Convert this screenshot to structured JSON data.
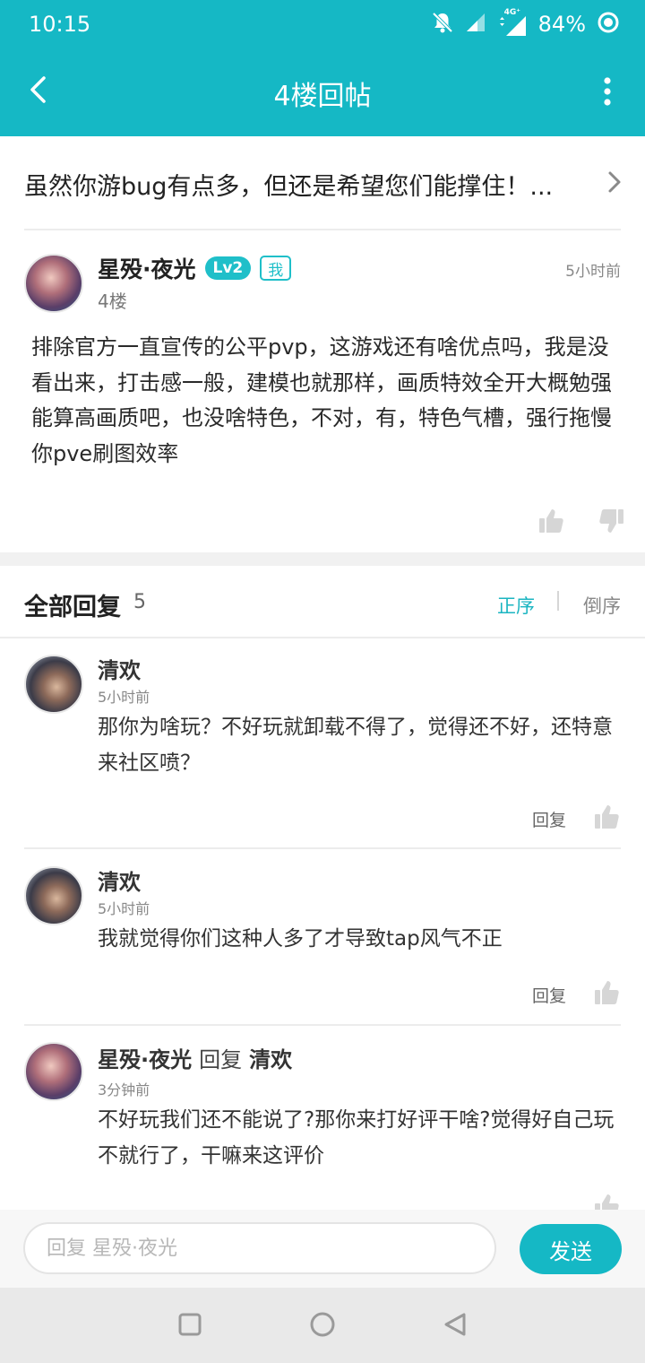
{
  "status_bar": {
    "time": "10:15",
    "battery_percent": "84%",
    "network_label": "4G⁺",
    "icons": [
      "notifications-off-icon",
      "signal-icon",
      "network-4g-icon",
      "battery-ring-icon"
    ]
  },
  "app_bar": {
    "title": "4楼回帖",
    "back_icon": "chevron-left-icon",
    "more_icon": "more-vertical-icon"
  },
  "topic": {
    "text": "虽然你游bug有点多，但还是希望您们能撑住！...",
    "chevron_icon": "chevron-right-icon"
  },
  "post": {
    "author": "星殁·夜光",
    "level": "Lv2",
    "me_badge": "我",
    "time": "5小时前",
    "floor": "4楼",
    "body": "排除官方一直宣传的公平pvp，这游戏还有啥优点吗，我是没看出来，打击感一般，建模也就那样，画质特效全开大概勉强能算高画质吧，也没啥特色，不对，有，特色气槽，强行拖慢你pve刷图效率"
  },
  "replies_header": {
    "title": "全部回复",
    "count": "5",
    "sort_asc": "正序",
    "sort_desc": "倒序"
  },
  "replies": [
    {
      "author": "清欢",
      "time": "5小时前",
      "text": "那你为啥玩？不好玩就卸载不得了，觉得还不好，还特意来社区喷？",
      "reply_label": "回复"
    },
    {
      "author": "清欢",
      "time": "5小时前",
      "text": "我就觉得你们这种人多了才导致tap风气不正",
      "reply_label": "回复"
    },
    {
      "author": "星殁·夜光",
      "reply_word": "回复",
      "target": "清欢",
      "time": "3分钟前",
      "text": "不好玩我们还不能说了?那你来打好评干啥?觉得好自己玩不就行了，干嘛来这评价"
    }
  ],
  "composer": {
    "placeholder": "回复 星殁·夜光",
    "send_label": "发送"
  },
  "colors": {
    "accent": "#15b8c5",
    "accent_text": "#1bb5c1"
  }
}
